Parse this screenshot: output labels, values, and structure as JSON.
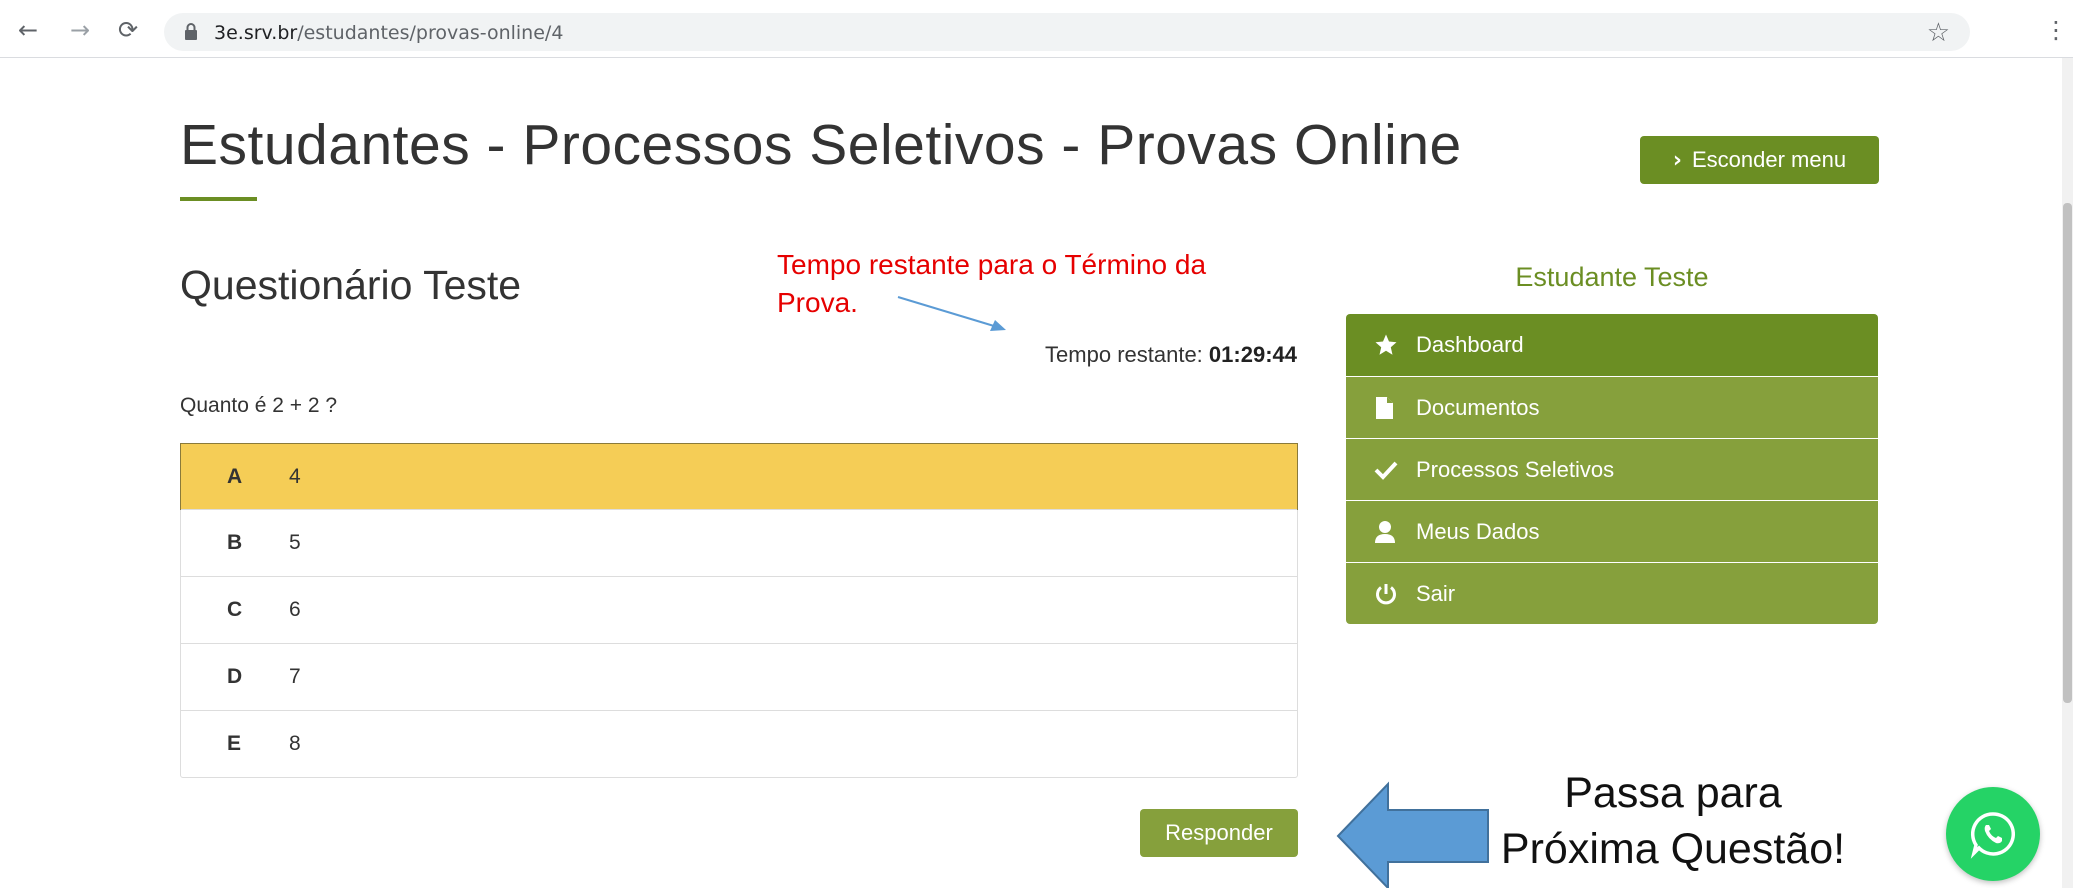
{
  "browser": {
    "url_host": "3e.srv.br",
    "url_path": "/estudantes/provas-online/4"
  },
  "page": {
    "title": "Estudantes - Processos Seletivos - Provas Online",
    "hide_menu_label": "Esconder menu"
  },
  "quiz": {
    "title": "Questionário Teste",
    "timer_label": "Tempo restante:",
    "timer_value": "01:29:44",
    "question": "Quanto é 2 + 2 ?",
    "options": [
      {
        "letter": "A",
        "value": "4",
        "selected": true
      },
      {
        "letter": "B",
        "value": "5",
        "selected": false
      },
      {
        "letter": "C",
        "value": "6",
        "selected": false
      },
      {
        "letter": "D",
        "value": "7",
        "selected": false
      },
      {
        "letter": "E",
        "value": "8",
        "selected": false
      }
    ],
    "reply_label": "Responder"
  },
  "sidebar": {
    "student_name": "Estudante Teste",
    "items": [
      {
        "label": "Dashboard",
        "icon": "star-icon"
      },
      {
        "label": "Documentos",
        "icon": "document-icon"
      },
      {
        "label": "Processos Seletivos",
        "icon": "check-icon"
      },
      {
        "label": "Meus Dados",
        "icon": "user-icon"
      },
      {
        "label": "Sair",
        "icon": "power-icon"
      }
    ]
  },
  "annotations": {
    "timer_note": "Tempo restante para o Término da Prova.",
    "next_line1": "Passa para",
    "next_line2": "Próxima Questão!"
  },
  "colors": {
    "primary_green": "#6b8e23",
    "menu_green": "#86a03c",
    "selected_option": "#f5cd56",
    "annotation_red": "#e60000",
    "annotation_arrow_blue": "#5b9bd5",
    "whatsapp_green": "#25d366"
  }
}
